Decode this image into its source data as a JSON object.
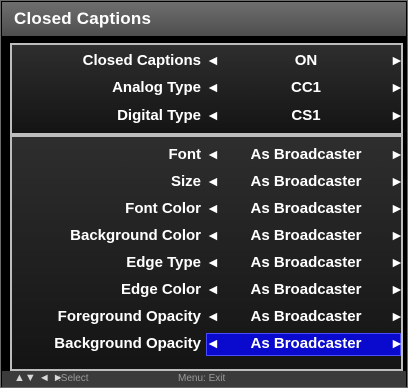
{
  "title": "Closed Captions",
  "group1": [
    {
      "label": "Closed Captions",
      "value": "ON"
    },
    {
      "label": "Analog Type",
      "value": "CC1"
    },
    {
      "label": "Digital Type",
      "value": "CS1"
    }
  ],
  "group2": [
    {
      "label": "Font",
      "value": "As Broadcaster"
    },
    {
      "label": "Size",
      "value": "As Broadcaster"
    },
    {
      "label": "Font Color",
      "value": "As Broadcaster"
    },
    {
      "label": "Background Color",
      "value": "As Broadcaster"
    },
    {
      "label": "Edge Type",
      "value": "As Broadcaster"
    },
    {
      "label": "Edge Color",
      "value": "As Broadcaster"
    },
    {
      "label": "Foreground Opacity",
      "value": "As Broadcaster"
    },
    {
      "label": "Background Opacity",
      "value": "As Broadcaster"
    }
  ],
  "arrows": {
    "left": "◄",
    "right": "►"
  },
  "footer": {
    "nav_glyphs": "▲▼ ◄ ►",
    "nav_hint": ":Select",
    "exit_hint": "Menu: Exit"
  },
  "colors": {
    "selection": "#0a0acf",
    "title_bar": "#5e5e5e"
  }
}
